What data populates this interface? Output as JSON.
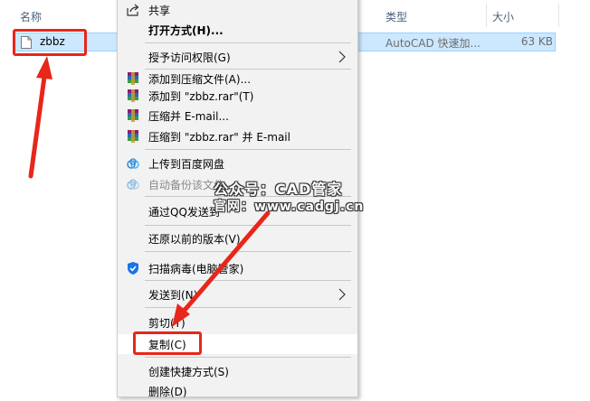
{
  "explorer": {
    "columns": {
      "name": "名称",
      "type": "类型",
      "size": "大小"
    },
    "file": {
      "name": "zbbz",
      "type": "AutoCAD 快速加...",
      "size": "63 KB"
    }
  },
  "context_menu": {
    "share": "共享",
    "open_with": "打开方式(H)...",
    "grant_access": "授予访问权限(G)",
    "add_archive": "添加到压缩文件(A)...",
    "add_rar": "添加到 \"zbbz.rar\"(T)",
    "compress_email": "压缩并 E-mail...",
    "compress_rar_email": "压缩到 \"zbbz.rar\" 并 E-mail",
    "upload_baidu": "上传到百度网盘",
    "auto_backup": "自动备份该文件",
    "send_qq": "通过QQ发送到",
    "restore_versions": "还原以前的版本(V)",
    "scan_virus": "扫描病毒(电脑管家)",
    "send_to": "发送到(N)",
    "cut": "剪切(T)",
    "copy": "复制(C)",
    "create_shortcut": "创建快捷方式(S)",
    "delete": "删除(D)"
  },
  "watermark": {
    "line1": "公众号：CAD管家",
    "line2": "官网：www.cadgj.cn"
  },
  "colors": {
    "selection_bg": "#cce8ff",
    "selection_border": "#99d1ff",
    "annotation_red": "#e8261a",
    "menu_bg": "#f2f2f2"
  },
  "icons": {
    "share": "share-icon",
    "winrar": "winrar-icon",
    "baidu": "baidu-cloud-icon",
    "shield": "shield-icon",
    "file": "file-icon",
    "submenu": "chevron-right-icon"
  }
}
